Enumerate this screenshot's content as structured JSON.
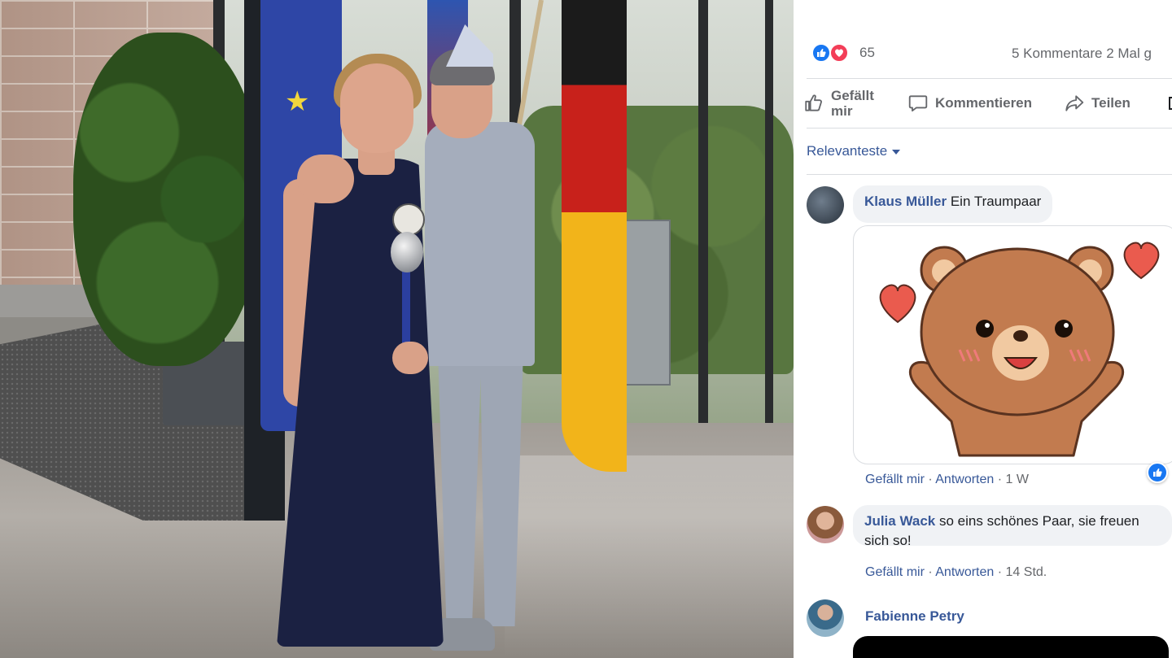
{
  "photo": {
    "description": "Two women standing in front of EU and German flags"
  },
  "post": {
    "reaction_count": "65",
    "comments_shares": "5 Kommentare  2 Mal g",
    "actions": {
      "like_label": "Gefällt mir",
      "comment_label": "Kommentieren",
      "share_label": "Teilen"
    },
    "sort_label": "Relevanteste"
  },
  "comments": [
    {
      "author": "Klaus Müller",
      "text": "Ein Traumpaar",
      "like_label": "Gefällt mir",
      "reply_label": "Antworten",
      "time": "1 W"
    },
    {
      "author": "Julia Wack",
      "text": "so eins schönes Paar, sie freuen sich so!",
      "like_label": "Gefällt mir",
      "reply_label": "Antworten",
      "time": "14 Std."
    },
    {
      "author": "Fabienne Petry"
    }
  ],
  "colors": {
    "link_blue": "#385898",
    "meta_gray": "#65676b",
    "bubble_bg": "#f0f2f5",
    "like_blue": "#1877f2",
    "love_red": "#f33e58"
  }
}
